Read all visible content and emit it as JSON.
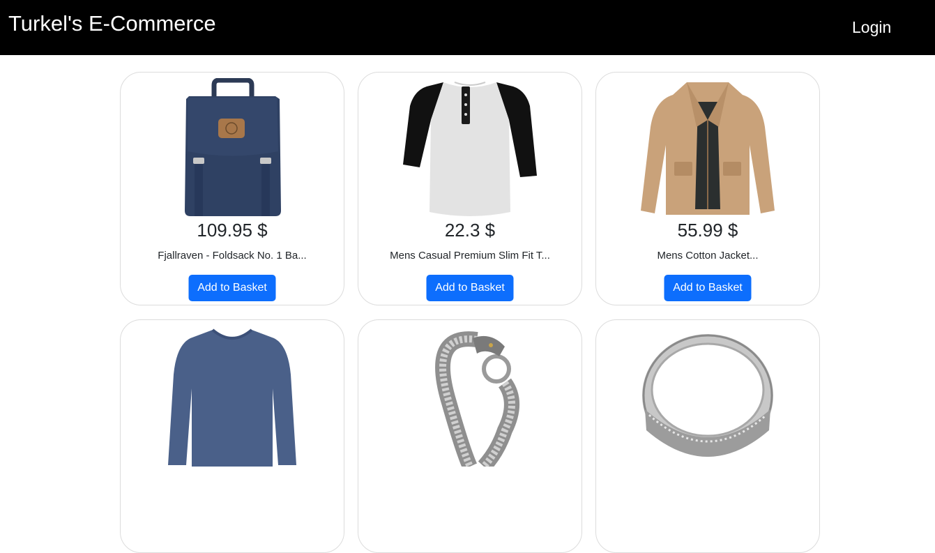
{
  "header": {
    "brand": "Turkel's E-Commerce",
    "login_label": "Login"
  },
  "colors": {
    "navbar": "#000000",
    "button": "#0d6efd",
    "card_border": "#dcdcdc"
  },
  "products": [
    {
      "price": "109.95 $",
      "title": "Fjallraven - Foldsack No. 1 Ba...",
      "button": "Add to Basket",
      "image": "backpack-image"
    },
    {
      "price": "22.3 $",
      "title": "Mens Casual Premium Slim Fit T...",
      "button": "Add to Basket",
      "image": "raglan-tshirt-image"
    },
    {
      "price": "55.99 $",
      "title": "Mens Cotton Jacket...",
      "button": "Add to Basket",
      "image": "jacket-image"
    },
    {
      "price": "",
      "title": "",
      "button": "",
      "image": "longsleeve-shirt-image"
    },
    {
      "price": "",
      "title": "",
      "button": "",
      "image": "dragon-bracelet-image"
    },
    {
      "price": "",
      "title": "",
      "button": "",
      "image": "silver-ring-image"
    }
  ]
}
